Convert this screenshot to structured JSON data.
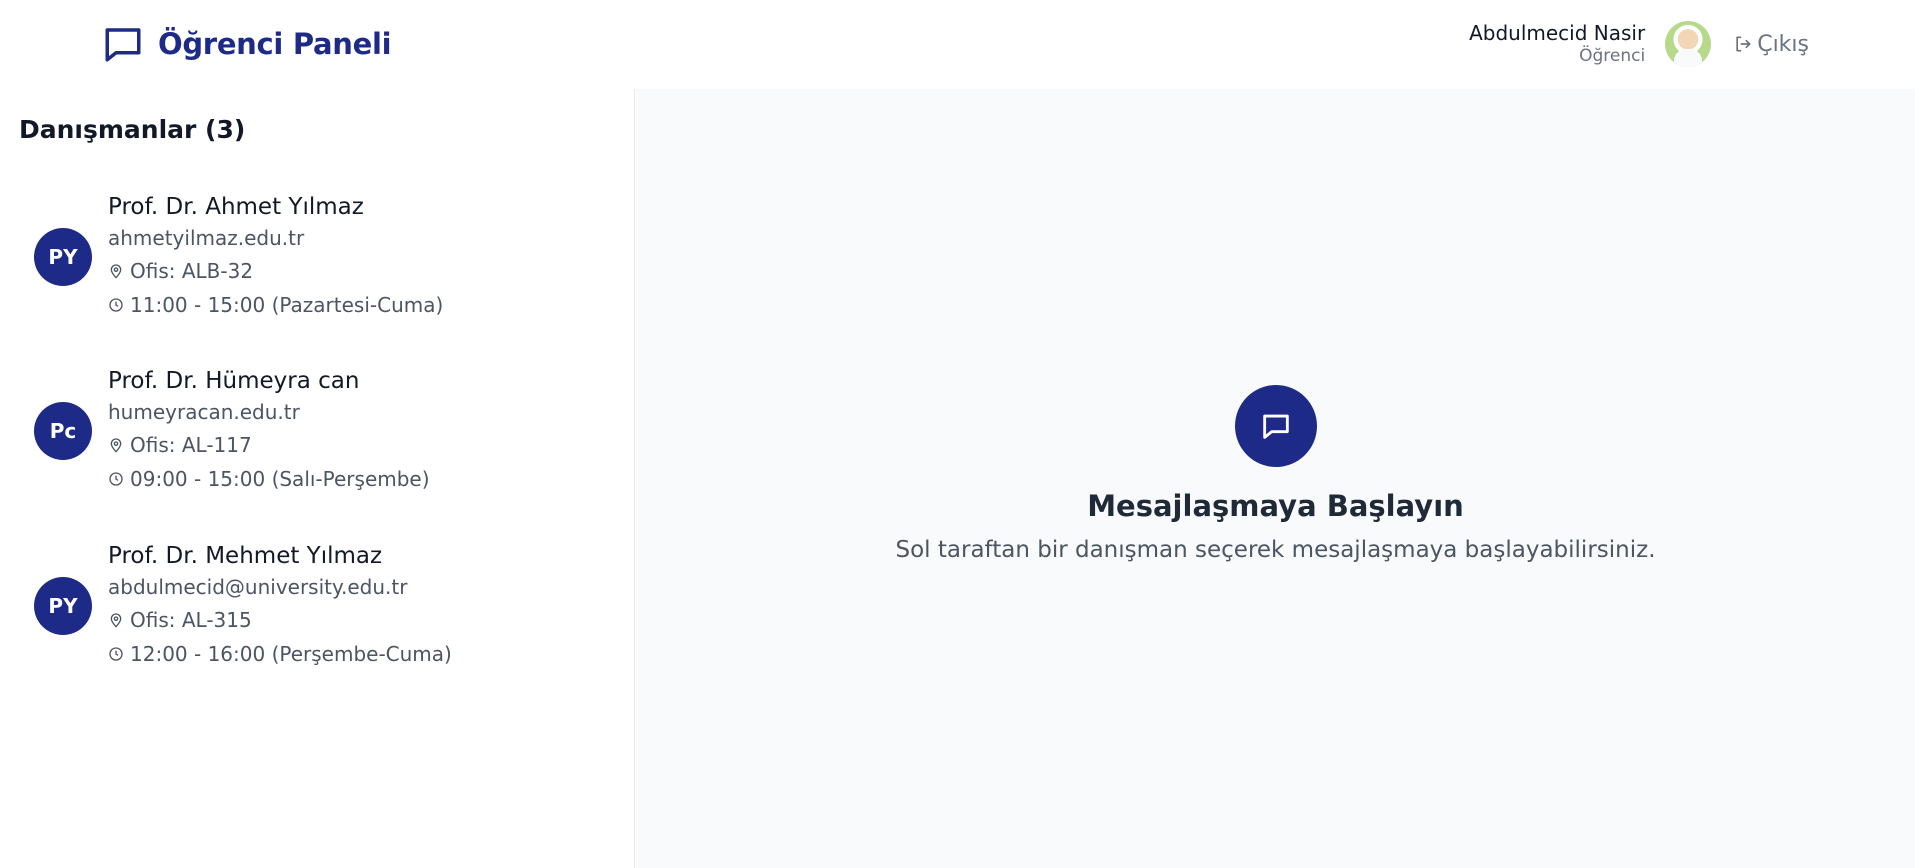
{
  "header": {
    "brand_icon": "chat-bubble-icon",
    "title": "Öğrenci Paneli",
    "user": {
      "name": "Abdulmecid Nasir",
      "role": "Öğrenci",
      "avatar": "user-photo"
    },
    "logout_icon": "logout-arrow-icon",
    "logout_label": "Çıkış"
  },
  "sidebar": {
    "title": "Danışmanlar (3)",
    "advisors": [
      {
        "initials": "PY",
        "name": "Prof. Dr. Ahmet Yılmaz",
        "email": "ahmetyilmaz.edu.tr",
        "office": "Ofis: ALB-32",
        "hours": "11:00 - 15:00 (Pazartesi-Cuma)"
      },
      {
        "initials": "Pc",
        "name": "Prof. Dr. Hümeyra can",
        "email": "humeyracan.edu.tr",
        "office": "Ofis: AL-117",
        "hours": "09:00 - 15:00 (Salı-Perşembe)"
      },
      {
        "initials": "PY",
        "name": "Prof. Dr. Mehmet Yılmaz",
        "email": "abdulmecid@university.edu.tr",
        "office": "Ofis: AL-315",
        "hours": "12:00 - 16:00 (Perşembe-Cuma)"
      }
    ]
  },
  "main": {
    "empty_icon": "chat-bubble-icon",
    "empty_title": "Mesajlaşmaya Başlayın",
    "empty_text": "Sol taraftan bir danışman seçerek mesajlaşmaya başlayabilirsiniz."
  },
  "colors": {
    "accent": "#1e2a87",
    "main_bg": "#f9fafb",
    "text_muted": "#6b7280"
  }
}
